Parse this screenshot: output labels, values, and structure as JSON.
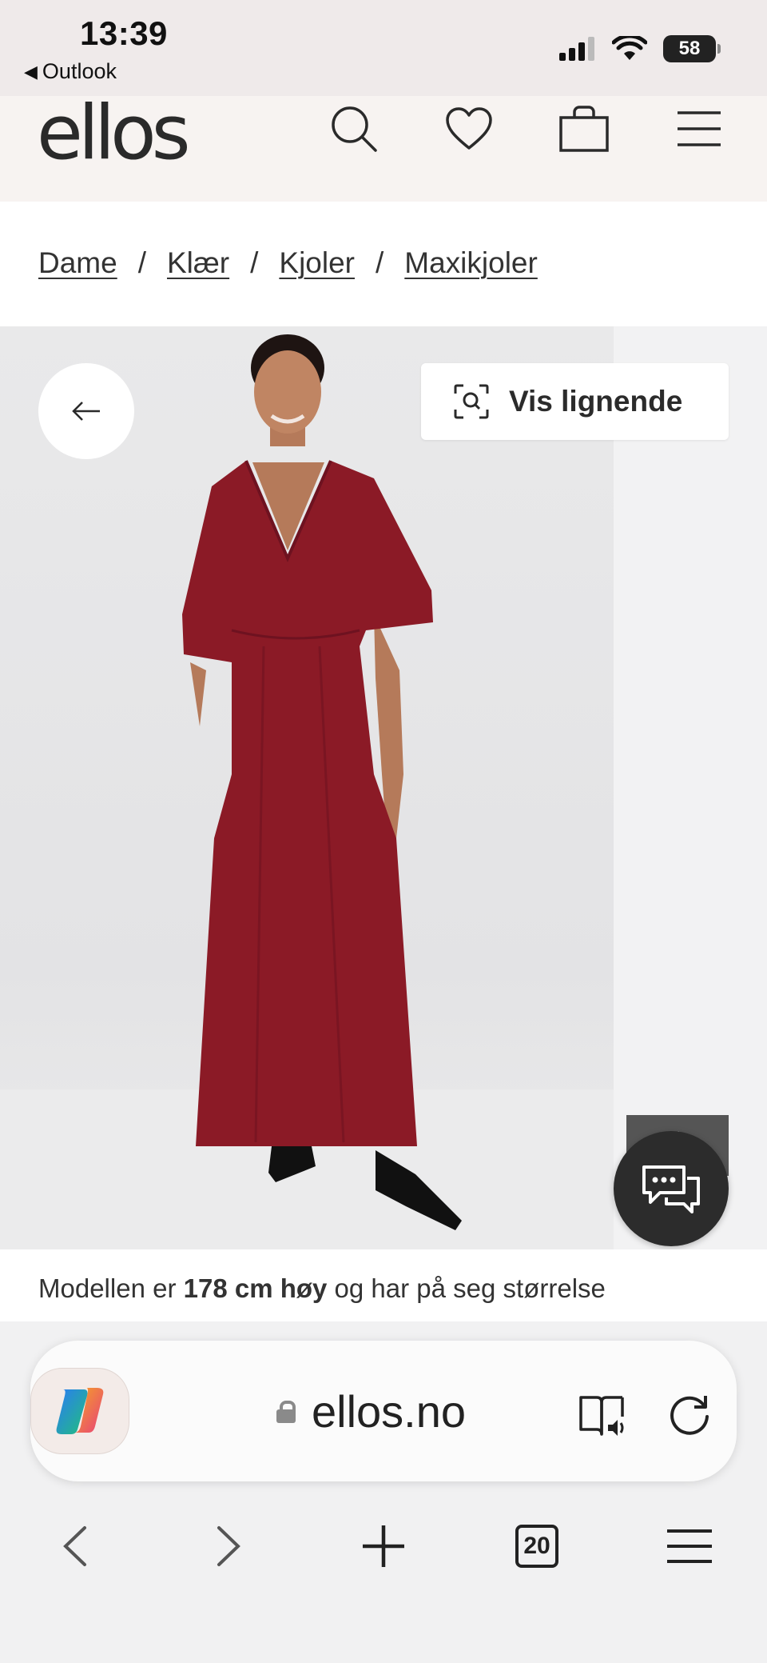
{
  "status_bar": {
    "time": "13:39",
    "back_app": "Outlook",
    "battery": "58"
  },
  "site": {
    "logo": "ellos"
  },
  "breadcrumb": [
    "Dame",
    "Klær",
    "Kjoler",
    "Maxikjoler"
  ],
  "product": {
    "similar_label": "Vis lignende"
  },
  "model_info": {
    "prefix": "Modellen er",
    "height": "178 cm høy",
    "suffix": "og har på seg størrelse"
  },
  "browser": {
    "url": "ellos.no",
    "tabs_count": "20"
  },
  "colors": {
    "dress": "#8b1a26",
    "header_bg": "#f7f3f1"
  }
}
